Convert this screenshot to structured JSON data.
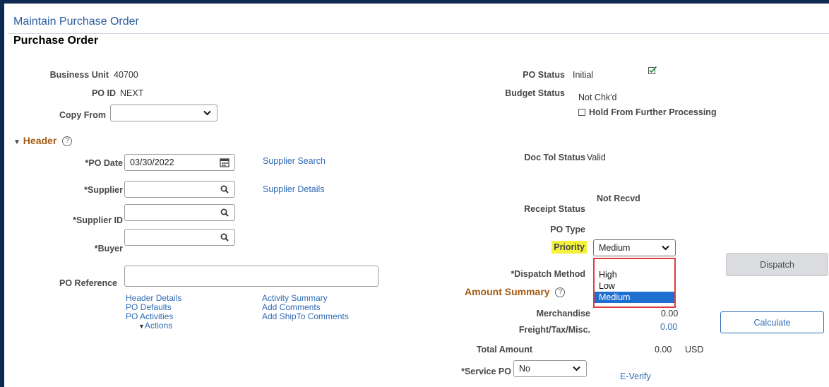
{
  "page": {
    "title": "Maintain Purchase Order",
    "subtitle": "Purchase Order"
  },
  "fields": {
    "business_unit": {
      "label": "Business Unit",
      "value": "40700"
    },
    "po_id": {
      "label": "PO ID",
      "value": "NEXT"
    },
    "copy_from": {
      "label": "Copy From",
      "value": ""
    }
  },
  "status": {
    "po_status": {
      "label": "PO Status",
      "value": "Initial"
    },
    "budget_status": {
      "label": "Budget Status",
      "value": "Not Chk'd"
    },
    "hold": {
      "label": "Hold From Further Processing",
      "checked": false
    },
    "doc_tol": {
      "label": "Doc Tol Status",
      "value": "Valid"
    },
    "receipt": {
      "label": "Receipt Status",
      "value": "Not Recvd"
    },
    "po_type": {
      "label": "PO Type",
      "value": ""
    }
  },
  "header": {
    "section_label": "Header",
    "help": "?",
    "po_date": {
      "label": "*PO Date",
      "value": "03/30/2022"
    },
    "supplier": {
      "label": "*Supplier",
      "value": ""
    },
    "supplier_id": {
      "label": "*Supplier ID",
      "value": ""
    },
    "buyer": {
      "label": "*Buyer",
      "value": ""
    },
    "po_reference": {
      "label": "PO Reference",
      "value": ""
    },
    "supplier_search_link": "Supplier Search",
    "supplier_details_link": "Supplier Details"
  },
  "links": {
    "header_details": "Header Details",
    "po_defaults": "PO Defaults",
    "po_activities": "PO Activities",
    "actions": "Actions",
    "activity_summary": "Activity Summary",
    "add_comments": "Add Comments",
    "add_shipto_comments": "Add ShipTo Comments"
  },
  "priority": {
    "label": "Priority",
    "value": "Medium",
    "options": [
      "High",
      "Low",
      "Medium"
    ],
    "selected_index": 2
  },
  "dispatch": {
    "method_label": "*Dispatch Method",
    "button": "Dispatch"
  },
  "amount_summary": {
    "label": "Amount Summary",
    "merchandise": {
      "label": "Merchandise",
      "value": "0.00"
    },
    "freight": {
      "label": "Freight/Tax/Misc.",
      "value": "0.00"
    },
    "total": {
      "label": "Total Amount",
      "value": "0.00",
      "currency": "USD"
    },
    "calculate_button": "Calculate"
  },
  "service_po": {
    "label": "*Service PO",
    "value": "No"
  },
  "everify_link": "E-Verify",
  "colors": {
    "frame_border": "#0f2a52",
    "link": "#2f6bb5",
    "section": "#a35a12",
    "highlight": "#f2f23c",
    "dropdown_outline": "#e23d3d",
    "selected_option": "#1f6fd1"
  }
}
